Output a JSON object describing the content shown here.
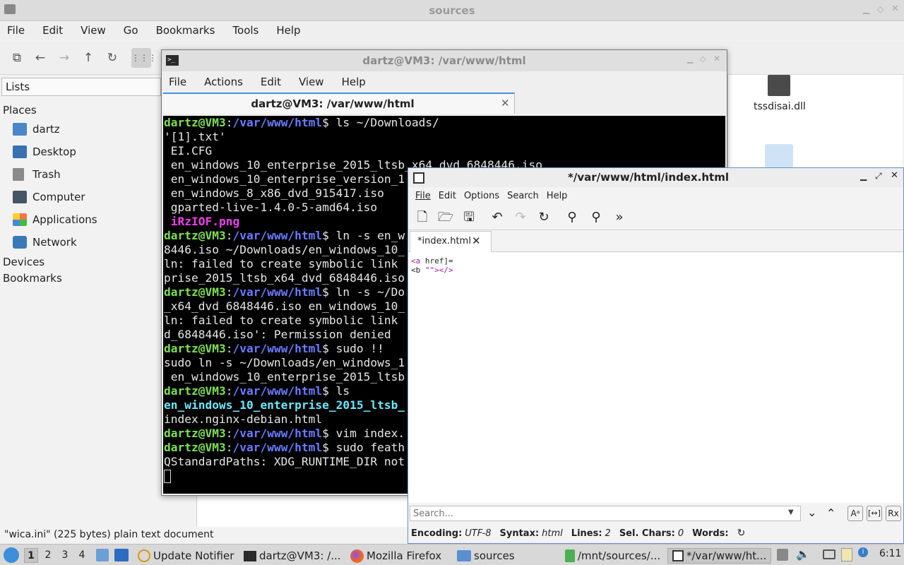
{
  "fm": {
    "title": "sources",
    "menu": [
      "File",
      "Edit",
      "View",
      "Go",
      "Bookmarks",
      "Tools",
      "Help"
    ],
    "lists_label": "Lists",
    "places_header": "Places",
    "places": [
      "dartz",
      "Desktop",
      "Trash",
      "Computer",
      "Applications",
      "Network"
    ],
    "devices_header": "Devices",
    "bookmarks_header": "Bookmarks",
    "file_label": "tssdisai.dll",
    "status": "\"wica.ini\" (225 bytes) plain text document"
  },
  "terminal": {
    "title": "dartz@VM3: /var/www/html",
    "menu": [
      "File",
      "Actions",
      "Edit",
      "View",
      "Help"
    ],
    "tab_label": "dartz@VM3: /var/www/html",
    "prompt_user": "dartz@VM3",
    "prompt_path": "/var/www/html",
    "lines": [
      {
        "cmd": "$ ls ~/Downloads/"
      },
      {
        "text": "'[1].txt'"
      },
      {
        "text": " EI.CFG"
      },
      {
        "text": " en_windows_10_enterprise_2015_ltsb_x64_dvd_6848446.iso"
      },
      {
        "text": " en_windows_10_enterprise_version_1"
      },
      {
        "text": " en_windows_8_x86_dvd_915417.iso"
      },
      {
        "text": " gparted-live-1.4.0-5-amd64.iso"
      },
      {
        "text": " iRzIOF.png",
        "style": "mg"
      },
      {
        "cmd": "$ ln -s en_w"
      },
      {
        "text": "8446.iso ~/Downloads/en_windows_10_"
      },
      {
        "text": "ln: failed to create symbolic link"
      },
      {
        "text": "prise_2015_ltsb_x64_dvd_6848446.iso"
      },
      {
        "cmd": "$ ln -s ~/Do"
      },
      {
        "text": "_x64_dvd_6848446.iso en_windows_10_"
      },
      {
        "text": "ln: failed to create symbolic link"
      },
      {
        "text": "d_6848446.iso': Permission denied"
      },
      {
        "cmd": "$ sudo !!"
      },
      {
        "text": "sudo ln -s ~/Downloads/en_windows_1"
      },
      {
        "text": " en_windows_10_enterprise_2015_ltsb"
      },
      {
        "cmd": "$ ls"
      },
      {
        "text": "en_windows_10_enterprise_2015_ltsb_",
        "style": "cy"
      },
      {
        "text": "index.nginx-debian.html"
      },
      {
        "cmd": "$ vim index."
      },
      {
        "cmd": "$ sudo feath"
      },
      {
        "text": "QStandardPaths: XDG_RUNTIME_DIR not"
      }
    ]
  },
  "editor": {
    "title": "*/var/www/html/index.html",
    "menu": [
      "File",
      "Edit",
      "Options",
      "Search",
      "Help"
    ],
    "tab_label": "*index.html",
    "code_line1_tag": "<a",
    "code_line1_rest": " href]=",
    "code_line2_tag": "<b",
    "code_line2_rest": " \"\"></>",
    "search_placeholder": "Search...",
    "status": {
      "encoding_label": "Encoding:",
      "encoding": "UTF-8",
      "syntax_label": "Syntax:",
      "syntax": "html",
      "lines_label": "Lines:",
      "lines": "2",
      "sel_label": "Sel. Chars:",
      "sel": "0",
      "words_label": "Words:"
    }
  },
  "taskbar": {
    "workspaces": [
      "1",
      "2",
      "3",
      "4"
    ],
    "tasks": [
      "Update Notifier",
      "dartz@VM3: /...",
      "Mozilla Firefox",
      "sources",
      "/mnt/sources/...",
      "*/var/www/ht..."
    ],
    "clock": "6:11"
  }
}
